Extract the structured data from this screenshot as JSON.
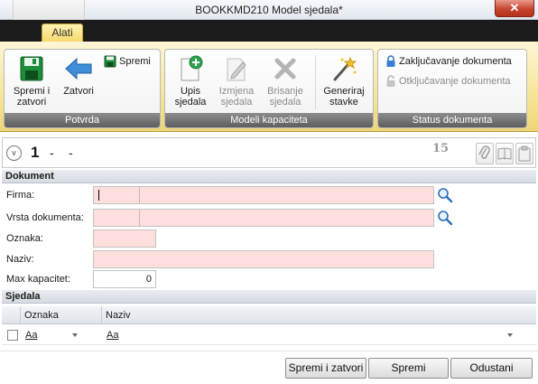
{
  "window": {
    "title": "BOOKKMD210  Model sjedala*",
    "close_glyph": "✕"
  },
  "ribbon": {
    "tab_label": "Alati",
    "groups": [
      {
        "label": "Potvrda",
        "buttons": [
          {
            "label": "Spremi i zatvori",
            "icon": "save-close-icon"
          },
          {
            "label": "Zatvori",
            "icon": "arrow-left-icon"
          },
          {
            "label": "Spremi",
            "icon": "save-icon"
          }
        ]
      },
      {
        "label": "Modeli kapaciteta",
        "buttons": [
          {
            "label": "Upis sjedala",
            "icon": "add-document-icon",
            "enabled": true
          },
          {
            "label": "Izmjena sjedala",
            "icon": "edit-document-icon",
            "enabled": false
          },
          {
            "label": "Brisanje sjedala",
            "icon": "delete-icon",
            "enabled": false
          },
          {
            "label": "Generiraj stavke",
            "icon": "magic-wand-icon",
            "enabled": true
          }
        ]
      },
      {
        "label": "Status dokumenta",
        "buttons": [
          {
            "label": "Zaključavanje dokumenta",
            "icon": "lock-icon",
            "enabled": true
          },
          {
            "label": "Otključavanje dokumenta",
            "icon": "unlock-icon",
            "enabled": false
          }
        ]
      }
    ]
  },
  "doc_header": {
    "collapse_glyph": "v",
    "number": "1",
    "dash1": "-",
    "dash2": "-",
    "count": "15",
    "tools": [
      "attach-icon",
      "book-icon",
      "clipboard-icon"
    ]
  },
  "dokument": {
    "section_title": "Dokument",
    "fields": {
      "firma": {
        "label": "Firma:",
        "code": "",
        "name": ""
      },
      "vrsta": {
        "label": "Vrsta dokumenta:",
        "code": "",
        "name": ""
      },
      "oznaka": {
        "label": "Oznaka:",
        "value": ""
      },
      "naziv": {
        "label": "Naziv:",
        "value": ""
      },
      "max_kapacitet": {
        "label": "Max kapacitet:",
        "value": "0"
      }
    }
  },
  "sjedala": {
    "section_title": "Sjedala",
    "columns": [
      "Oznaka",
      "Naziv"
    ],
    "filter_row": {
      "oznaka": "Aa",
      "naziv": "Aa"
    }
  },
  "footer": {
    "save_close": "Spremi i zatvori",
    "save": "Spremi",
    "cancel": "Odustani"
  },
  "colors": {
    "required_field": "#ffdede",
    "ribbon_bg": "#f5e28f",
    "group_label_bg": "#6b6b6b",
    "close_button": "#c6452f"
  }
}
